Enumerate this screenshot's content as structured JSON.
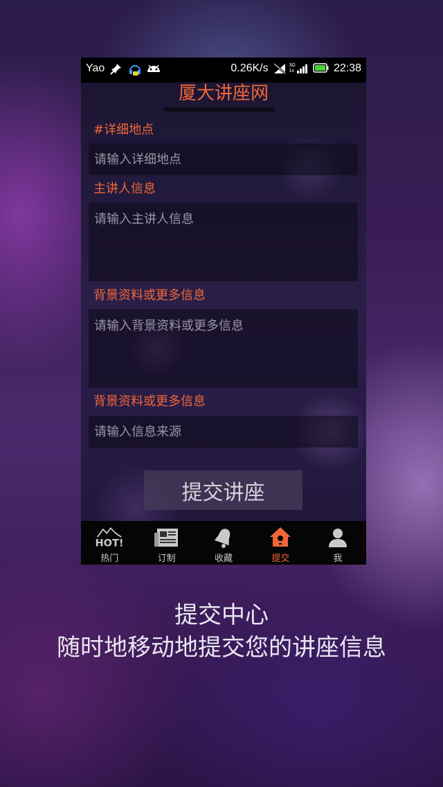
{
  "status_bar": {
    "carrier": "Yao",
    "speed": "0.26K/s",
    "network_top": "3G",
    "network_bottom": "1x",
    "time": "22:38",
    "icons": [
      "pin-icon",
      "headset-icon",
      "android-icon",
      "signal-muted-icon",
      "battery-icon"
    ]
  },
  "header": {
    "title": "厦大讲座网"
  },
  "form": {
    "fields": [
      {
        "label": "#详细地点",
        "placeholder": "请输入详细地点"
      },
      {
        "label": "主讲人信息",
        "placeholder": "请输入主讲人信息"
      },
      {
        "label": "背景资料或更多信息",
        "placeholder": "请输入背景资料或更多信息"
      },
      {
        "label": "背景资料或更多信息",
        "placeholder": "请输入信息来源"
      }
    ],
    "submit_label": "提交讲座"
  },
  "bottom_nav": {
    "items": [
      {
        "label": "热门",
        "icon": "hot-icon",
        "active": false
      },
      {
        "label": "订制",
        "icon": "newspaper-icon",
        "active": false
      },
      {
        "label": "收藏",
        "icon": "bell-icon",
        "active": false
      },
      {
        "label": "提交",
        "icon": "birdhouse-icon",
        "active": true
      },
      {
        "label": "我",
        "icon": "person-icon",
        "active": false
      }
    ],
    "hot_badge_text": "HOT!"
  },
  "caption": {
    "title": "提交中心",
    "subtitle": "随时地移动地提交您的讲座信息"
  },
  "colors": {
    "accent": "#f0663a",
    "status_bar_bg": "#000000",
    "nav_bg": "#050505"
  }
}
